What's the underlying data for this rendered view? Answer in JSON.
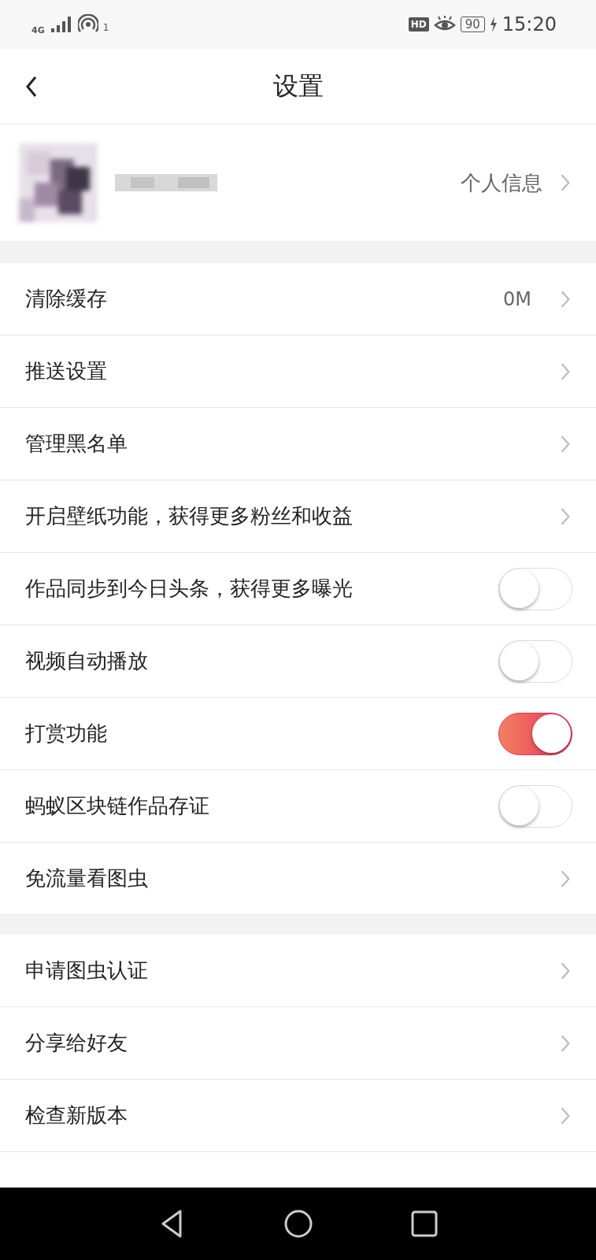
{
  "status_bar": {
    "network": "4G",
    "hotspot_count": "1",
    "hd": "HD",
    "battery": "90",
    "time": "15:20"
  },
  "header": {
    "title": "设置"
  },
  "profile": {
    "link": "个人信息"
  },
  "sections": [
    {
      "items": [
        {
          "kind": "chevron",
          "label": "清除缓存",
          "value": "0M"
        },
        {
          "kind": "chevron",
          "label": "推送设置"
        },
        {
          "kind": "chevron",
          "label": "管理黑名单"
        },
        {
          "kind": "chevron",
          "label": "开启壁纸功能，获得更多粉丝和收益"
        },
        {
          "kind": "toggle",
          "label": "作品同步到今日头条，获得更多曝光",
          "on": false
        },
        {
          "kind": "toggle",
          "label": "视频自动播放",
          "on": false
        },
        {
          "kind": "toggle",
          "label": "打赏功能",
          "on": true
        },
        {
          "kind": "toggle",
          "label": "蚂蚁区块链作品存证",
          "on": false
        },
        {
          "kind": "chevron",
          "label": "免流量看图虫"
        }
      ]
    },
    {
      "items": [
        {
          "kind": "chevron",
          "label": "申请图虫认证"
        },
        {
          "kind": "chevron",
          "label": "分享给好友"
        },
        {
          "kind": "chevron",
          "label": "检查新版本"
        }
      ]
    }
  ]
}
